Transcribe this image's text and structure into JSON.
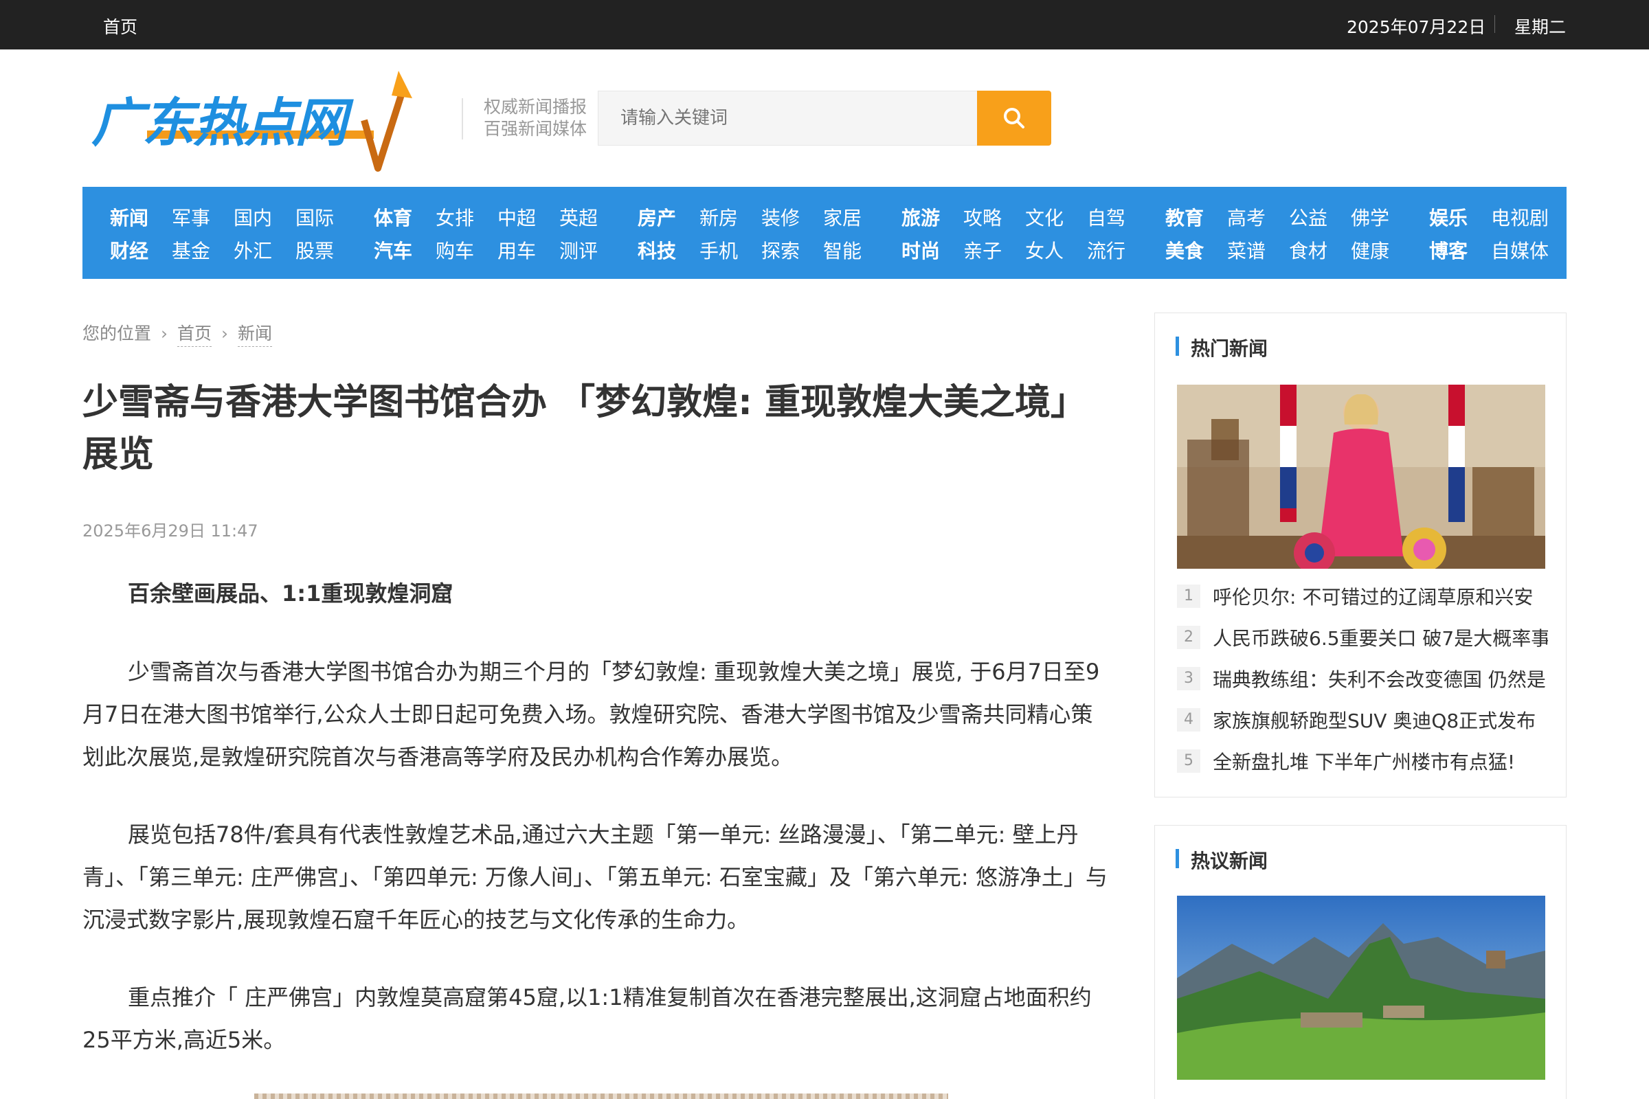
{
  "topbar": {
    "home": "首页",
    "date": "2025年07月22日",
    "weekday": "星期二"
  },
  "logo": {
    "text": "广东热点网"
  },
  "header": {
    "slogan_line1": "权威新闻播报",
    "slogan_line2": "百强新闻媒体"
  },
  "search": {
    "placeholder": "请输入关键词"
  },
  "nav": {
    "groups": [
      {
        "row1": [
          "新闻",
          "军事",
          "国内",
          "国际"
        ],
        "row2": [
          "财经",
          "基金",
          "外汇",
          "股票"
        ]
      },
      {
        "row1": [
          "体育",
          "女排",
          "中超",
          "英超"
        ],
        "row2": [
          "汽车",
          "购车",
          "用车",
          "测评"
        ]
      },
      {
        "row1": [
          "房产",
          "新房",
          "装修",
          "家居"
        ],
        "row2": [
          "科技",
          "手机",
          "探索",
          "智能"
        ]
      },
      {
        "row1": [
          "旅游",
          "攻略",
          "文化",
          "自驾"
        ],
        "row2": [
          "时尚",
          "亲子",
          "女人",
          "流行"
        ]
      },
      {
        "row1": [
          "教育",
          "高考",
          "公益",
          "佛学"
        ],
        "row2": [
          "美食",
          "菜谱",
          "食材",
          "健康"
        ]
      },
      {
        "row1": [
          "娱乐",
          "电视剧"
        ],
        "row2": [
          "博客",
          "自媒体"
        ]
      }
    ]
  },
  "breadcrumb": {
    "label": "您的位置",
    "home": "首页",
    "section": "新闻"
  },
  "article": {
    "title": "少雪斋与香港大学图书馆合办 「梦幻敦煌: 重现敦煌大美之境」展览",
    "date": "2025年6月29日 11:47",
    "lead": "百余壁画展品、1:1重现敦煌洞窟",
    "p1": "少雪斋首次与香港大学图书馆合办为期三个月的「梦幻敦煌: 重现敦煌大美之境」展览, 于6月7日至9月7日在港大图书馆举行,公众人士即日起可免费入场。敦煌研究院、香港大学图书馆及少雪斋共同精心策划此次展览,是敦煌研究院首次与香港高等学府及民办机构合作筹办展览。",
    "p2": "展览包括78件/套具有代表性敦煌艺术品,通过六大主题「第一单元: 丝路漫漫」、「第二单元: 壁上丹青」、「第三单元: 庄严佛宫」、「第四单元: 万像人间」、「第五单元: 石室宝藏」及「第六单元: 悠游净土」与沉浸式数字影片,展现敦煌石窟千年匠心的技艺与文化传承的生命力。",
    "p3": "重点推介「 庄严佛宫」内敦煌莫高窟第45窟,以1:1精准复制首次在香港完整展出,这洞窟占地面积约25平方米,高近5米。"
  },
  "sidebar": {
    "hot": {
      "title": "热门新闻",
      "items": [
        {
          "rank": "1",
          "text": "呼伦贝尔: 不可错过的辽阔草原和兴安"
        },
        {
          "rank": "2",
          "text": "人民币跌破6.5重要关口 破7是大概率事"
        },
        {
          "rank": "3",
          "text": "瑞典教练组：失利不会改变德国 仍然是"
        },
        {
          "rank": "4",
          "text": "家族旗舰轿跑型SUV 奥迪Q8正式发布"
        },
        {
          "rank": "5",
          "text": "全新盘扎堆 下半年广州楼市有点猛!"
        }
      ]
    },
    "discussed": {
      "title": "热议新闻"
    }
  },
  "colors": {
    "accent_blue": "#2d90e0",
    "search_orange": "#f8a01a",
    "topbar_bg": "#222222"
  }
}
